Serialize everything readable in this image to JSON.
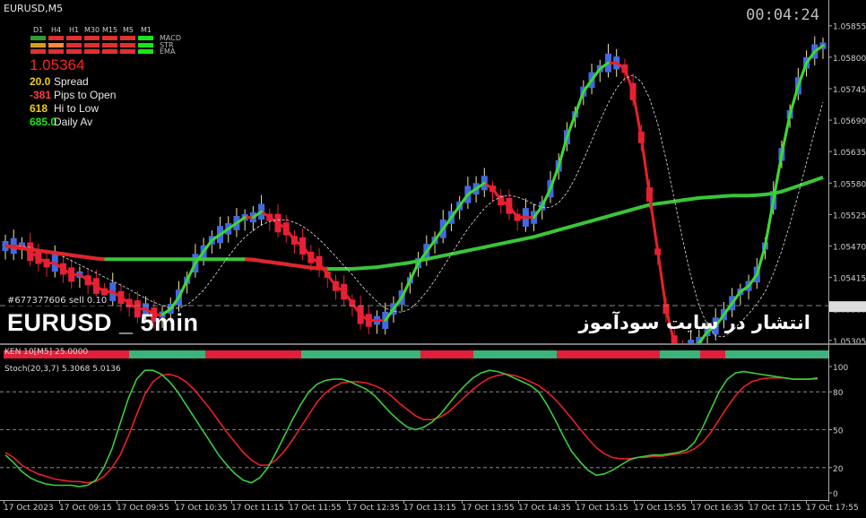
{
  "window": {
    "symbol": "EURUSD,M5",
    "timer": "00:04:24"
  },
  "dashboard": {
    "timeframes": [
      "D1",
      "H4",
      "H1",
      "M30",
      "M15",
      "M5",
      "M1"
    ],
    "indicators": [
      "MACD",
      "STR",
      "EMA"
    ],
    "colors": {
      "MACD": [
        "#2e9d2e",
        "#e03030",
        "#e03030",
        "#e03030",
        "#e03030",
        "#e03030",
        "#19e619"
      ],
      "STR": [
        "#d4a017",
        "#ff8a3d",
        "#e03030",
        "#e03030",
        "#e03030",
        "#e03030",
        "#19e619"
      ],
      "EMA": [
        "#e03030",
        "#e03030",
        "#e03030",
        "#e03030",
        "#e03030",
        "#e03030",
        "#19e619"
      ]
    },
    "price": "1.05364",
    "rows": [
      {
        "value": "20.0",
        "label": "Spread",
        "color": "#f0d000"
      },
      {
        "value": "-381",
        "label": "Pips to Open",
        "color": "#ff4040"
      },
      {
        "value": "618",
        "label": "Hi to Low",
        "color": "#f0d000"
      },
      {
        "value": "685.0",
        "label": "Daily Av",
        "color": "#19e619"
      }
    ]
  },
  "order_label": "#677377606 sell 0.10",
  "watermark_en": "EURUSD _ 5min",
  "watermark_fa": "انتشار در سایت سودآموز",
  "price_axis": [
    "1.05855",
    "1.05800",
    "1.05745",
    "1.05690",
    "1.05635",
    "1.05580",
    "1.05525",
    "1.05470",
    "1.05415",
    "1.05360",
    "1.05305"
  ],
  "ken_label": "KEN 10[M5] 25.0000",
  "stoch_label": "Stoch(20,3,7) 5.3068 5.0136",
  "stoch_axis": [
    "100",
    "80",
    "50",
    "20",
    "0"
  ],
  "time_axis": [
    "17 Oct 2023",
    "17 Oct 09:15",
    "17 Oct 09:55",
    "17 Oct 10:35",
    "17 Oct 11:15",
    "17 Oct 11:55",
    "17 Oct 12:35",
    "17 Oct 13:15",
    "17 Oct 13:55",
    "17 Oct 14:35",
    "17 Oct 15:15",
    "17 Oct 15:55",
    "17 Oct 16:35",
    "17 Oct 17:15",
    "17 Oct 17:55"
  ],
  "chart_data": [
    {
      "type": "candlestick",
      "title": "EURUSD,M5",
      "ylim": [
        1.053,
        1.059
      ],
      "current_price": 1.05364,
      "fast_ma": [
        1.0547,
        1.0547,
        1.0547,
        1.0546,
        1.0545,
        1.0544,
        1.0544,
        1.0543,
        1.0542,
        1.0542,
        1.0541,
        1.054,
        1.0539,
        1.0539,
        1.0538,
        1.0537,
        1.0536,
        1.0536,
        1.0535,
        1.0535,
        1.0536,
        1.0538,
        1.0541,
        1.0544,
        1.0546,
        1.0548,
        1.0549,
        1.055,
        1.0551,
        1.0552,
        1.0552,
        1.0553,
        1.0552,
        1.0551,
        1.055,
        1.0548,
        1.0547,
        1.0545,
        1.0544,
        1.0542,
        1.054,
        1.0539,
        1.0537,
        1.0535,
        1.0534,
        1.0534,
        1.0534,
        1.0536,
        1.0538,
        1.0541,
        1.0544,
        1.0546,
        1.0548,
        1.055,
        1.0552,
        1.0554,
        1.0556,
        1.0557,
        1.0558,
        1.0557,
        1.0555,
        1.0554,
        1.0552,
        1.0552,
        1.0552,
        1.0554,
        1.0557,
        1.0561,
        1.0566,
        1.057,
        1.0574,
        1.0576,
        1.0578,
        1.0579,
        1.0579,
        1.0578,
        1.0574,
        1.0566,
        1.0556,
        1.0546,
        1.0536,
        1.053,
        1.0529,
        1.0529,
        1.053,
        1.0532,
        1.0533,
        1.0535,
        1.0537,
        1.0539,
        1.054,
        1.0542,
        1.0547,
        1.0555,
        1.0563,
        1.057,
        1.0575,
        1.0579,
        1.0581,
        1.0582
      ],
      "slow_ma": [
        1.0547,
        1.05468,
        1.05466,
        1.05464,
        1.05462,
        1.0546,
        1.05458,
        1.05456,
        1.05454,
        1.05452,
        1.0545,
        1.05448,
        1.05447,
        1.05447,
        1.05447,
        1.05447,
        1.05447,
        1.05447,
        1.05447,
        1.05447,
        1.05447,
        1.05447,
        1.05447,
        1.05447,
        1.05447,
        1.05447,
        1.05447,
        1.05447,
        1.05447,
        1.05447,
        1.05446,
        1.05444,
        1.05442,
        1.0544,
        1.05438,
        1.05436,
        1.05434,
        1.05432,
        1.05431,
        1.0543,
        1.0543,
        1.0543,
        1.0543,
        1.05431,
        1.05432,
        1.05433,
        1.05435,
        1.05437,
        1.05439,
        1.05441,
        1.05444,
        1.05447,
        1.0545,
        1.05453,
        1.05456,
        1.05459,
        1.05462,
        1.05465,
        1.05468,
        1.05471,
        1.05474,
        1.05477,
        1.0548,
        1.05483,
        1.05486,
        1.0549,
        1.05494,
        1.05498,
        1.05502,
        1.05506,
        1.0551,
        1.05514,
        1.05518,
        1.05522,
        1.05526,
        1.0553,
        1.05534,
        1.05538,
        1.05542,
        1.05544,
        1.05546,
        1.05548,
        1.0555,
        1.05552,
        1.05554,
        1.05555,
        1.05556,
        1.05557,
        1.05558,
        1.05558,
        1.05558,
        1.05559,
        1.0556,
        1.05562,
        1.05565,
        1.0557,
        1.05575,
        1.0558,
        1.05585,
        1.0559
      ]
    },
    {
      "type": "line",
      "title": "Stoch(20,3,7) 5.3068 5.0136",
      "ylim": [
        0,
        100
      ],
      "levels": [
        20,
        50,
        80
      ],
      "main": [
        30,
        24,
        17,
        12,
        9,
        7,
        6,
        6,
        6,
        5,
        6,
        10,
        20,
        35,
        55,
        75,
        90,
        97,
        97,
        94,
        88,
        80,
        70,
        60,
        50,
        40,
        30,
        22,
        15,
        10,
        8,
        12,
        20,
        32,
        45,
        58,
        70,
        80,
        86,
        89,
        90,
        90,
        88,
        85,
        82,
        77,
        70,
        63,
        57,
        52,
        50,
        52,
        56,
        62,
        70,
        78,
        85,
        91,
        95,
        97,
        96,
        94,
        91,
        88,
        85,
        80,
        70,
        58,
        45,
        33,
        25,
        18,
        14,
        15,
        18,
        22,
        26,
        28,
        29,
        30,
        30,
        31,
        32,
        34,
        40,
        52,
        66,
        80,
        90,
        95,
        96,
        95,
        94,
        93,
        92,
        91,
        90,
        90,
        90,
        91
      ],
      "signal": [
        32,
        28,
        22,
        18,
        15,
        13,
        11,
        10,
        9,
        9,
        8,
        9,
        13,
        20,
        30,
        45,
        62,
        78,
        88,
        93,
        94,
        92,
        88,
        82,
        74,
        66,
        57,
        48,
        40,
        32,
        26,
        22,
        22,
        26,
        33,
        42,
        52,
        62,
        72,
        79,
        84,
        87,
        88,
        88,
        87,
        85,
        82,
        77,
        71,
        66,
        61,
        58,
        58,
        60,
        64,
        70,
        76,
        82,
        87,
        91,
        93,
        94,
        93,
        91,
        88,
        85,
        80,
        74,
        67,
        59,
        51,
        43,
        36,
        31,
        28,
        27,
        27,
        28,
        28,
        29,
        29,
        30,
        31,
        32,
        35,
        40,
        48,
        58,
        68,
        77,
        84,
        88,
        90,
        91,
        91,
        91,
        90,
        90,
        90,
        90
      ]
    }
  ]
}
